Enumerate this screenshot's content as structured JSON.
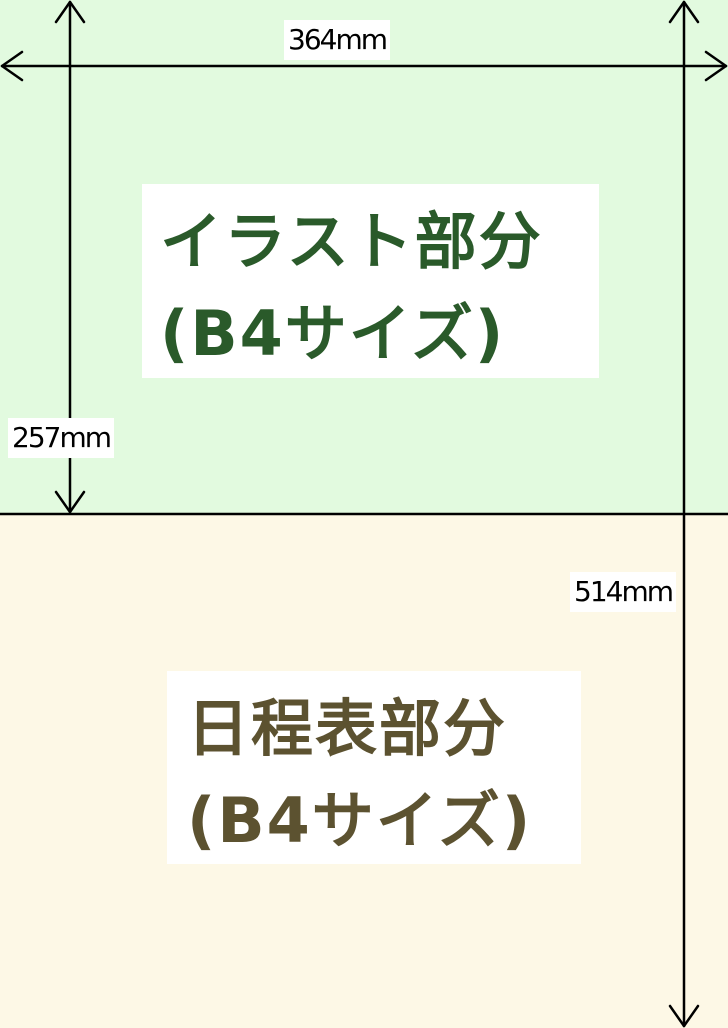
{
  "regions": {
    "top": {
      "line1": "イラスト部分",
      "line2": "(B4サイズ)",
      "background": "#e2fadf",
      "text_color": "#2a5a2a"
    },
    "bottom": {
      "line1": "日程表部分",
      "line2": "(B4サイズ)",
      "background": "#fdf8e6",
      "text_color": "#5c5230"
    }
  },
  "dimensions": {
    "width": "364mm",
    "half_height": "257mm",
    "full_height": "514mm"
  }
}
